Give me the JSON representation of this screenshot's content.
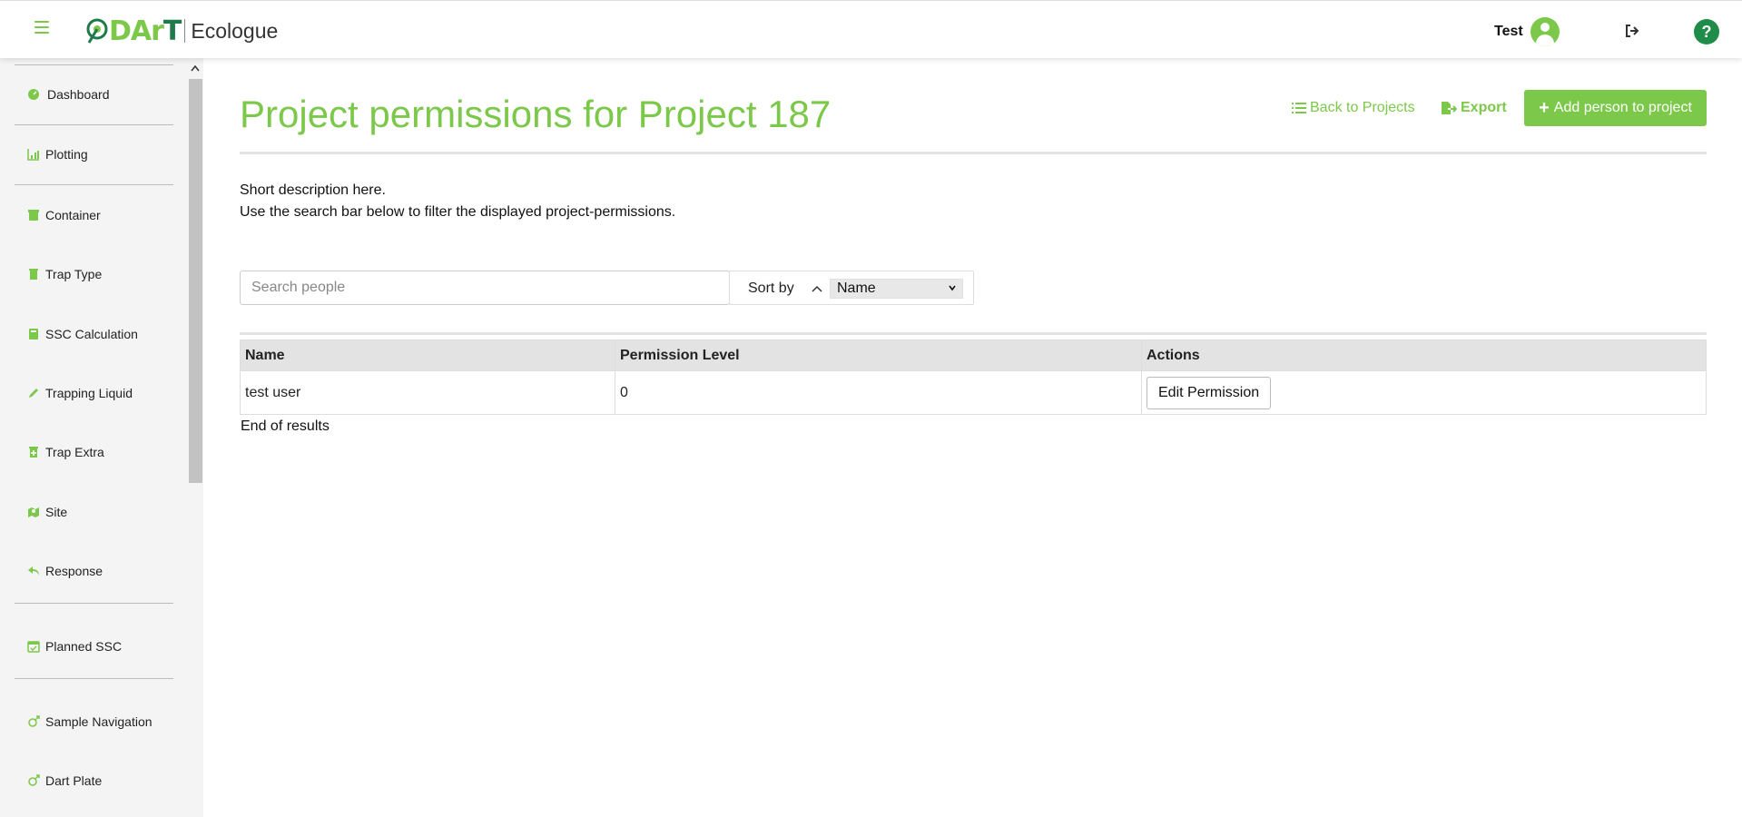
{
  "header": {
    "brand_mark": "DArT",
    "brand_name": "Ecologue",
    "user_name": "Test"
  },
  "sidebar": {
    "items": [
      {
        "label": "Dashboard",
        "icon": "dashboard-icon"
      },
      {
        "label": "Plotting",
        "icon": "chart-icon"
      },
      {
        "label": "Container",
        "icon": "container-icon"
      },
      {
        "label": "Trap Type",
        "icon": "trash-icon"
      },
      {
        "label": "SSC Calculation",
        "icon": "calculator-icon"
      },
      {
        "label": "Trapping Liquid",
        "icon": "pen-icon"
      },
      {
        "label": "Trap Extra",
        "icon": "trash-plus-icon"
      },
      {
        "label": "Site",
        "icon": "map-icon"
      },
      {
        "label": "Response",
        "icon": "reply-icon"
      },
      {
        "label": "Planned SSC",
        "icon": "calendar-check-icon"
      },
      {
        "label": "Sample Navigation",
        "icon": "arrow-out-icon"
      },
      {
        "label": "Dart Plate",
        "icon": "arrow-out-icon"
      }
    ]
  },
  "main": {
    "title": "Project permissions for Project 187",
    "back_label": "Back to Projects",
    "export_label": "Export",
    "add_label": "Add person to project",
    "description_line1": "Short description here.",
    "description_line2": "Use the search bar below to filter the displayed project-permissions.",
    "search_placeholder": "Search people",
    "sort_label": "Sort by",
    "sort_value": "Name",
    "end_of_results": "End of results"
  },
  "table": {
    "headers": [
      "Name",
      "Permission Level",
      "Actions"
    ],
    "rows": [
      {
        "name": "test user",
        "permission_level": "0",
        "action_label": "Edit Permission"
      }
    ]
  },
  "colors": {
    "accent": "#7cc84a",
    "accent_dark": "#1f8c4a"
  }
}
